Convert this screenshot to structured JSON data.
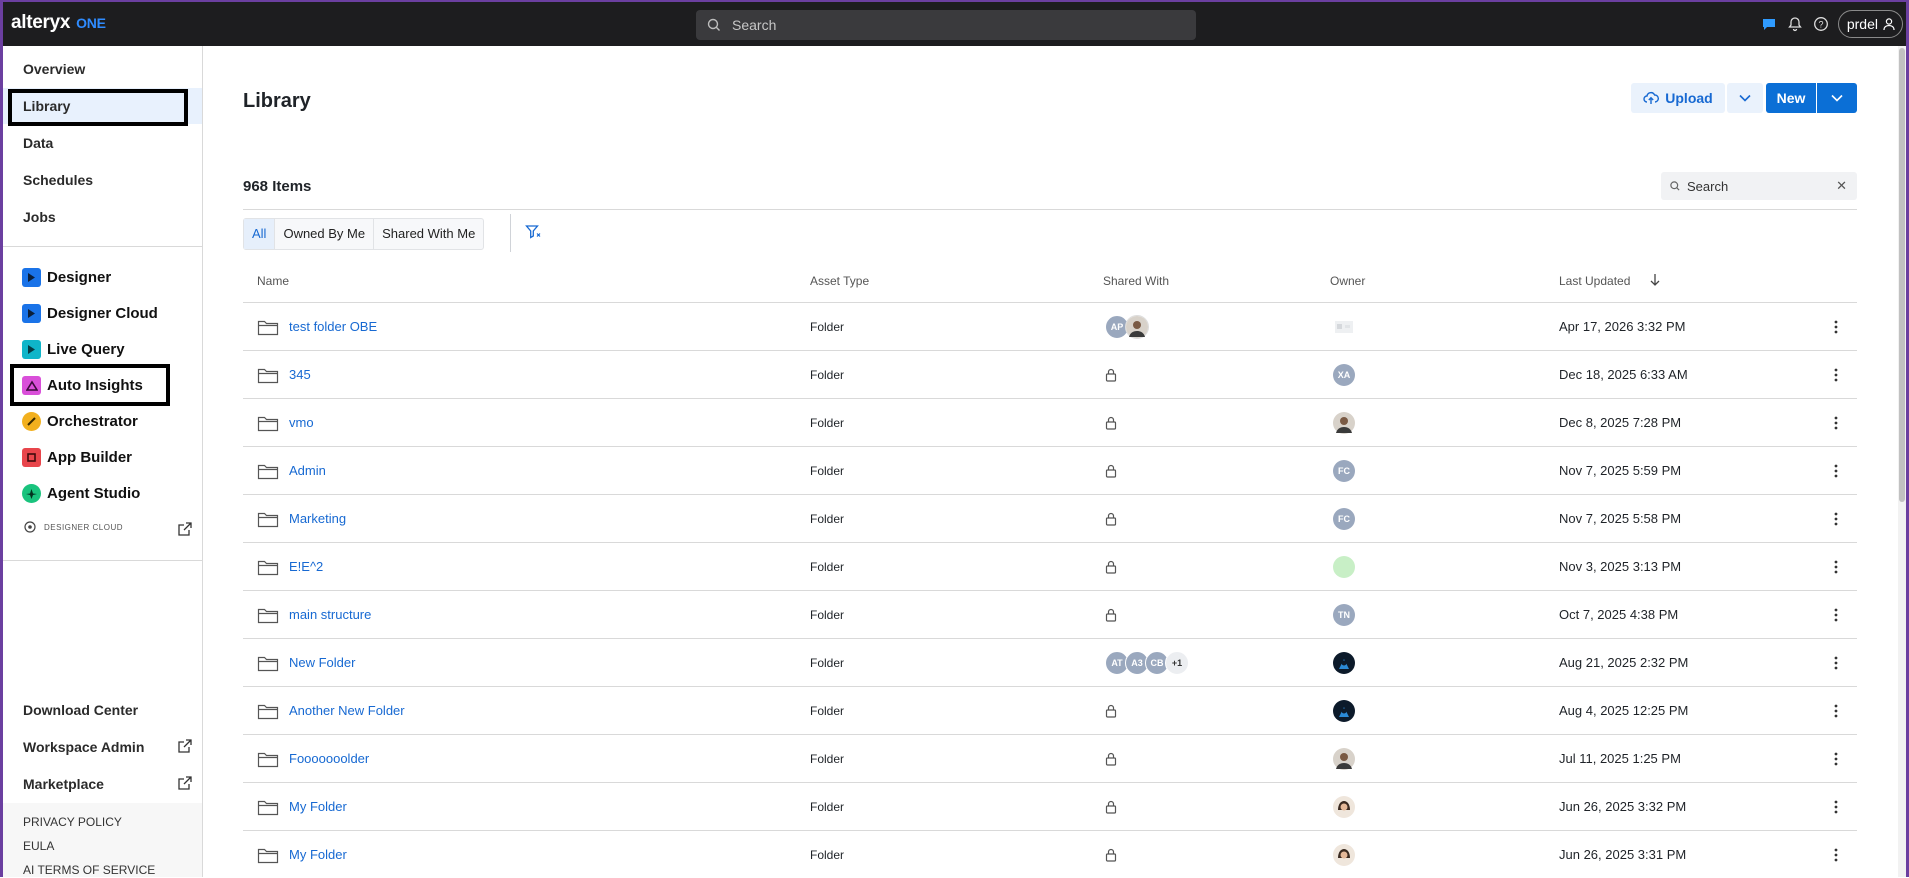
{
  "topbar": {
    "logo_main": "alteryx",
    "logo_sub": "ONE",
    "search_placeholder": "Search",
    "user": "prdel"
  },
  "sidebar": {
    "nav": [
      {
        "label": "Overview"
      },
      {
        "label": "Library"
      },
      {
        "label": "Data"
      },
      {
        "label": "Schedules"
      },
      {
        "label": "Jobs"
      }
    ],
    "apps": [
      {
        "label": "Designer",
        "icon": "designer-icon",
        "color": "#1a73e8"
      },
      {
        "label": "Designer Cloud",
        "icon": "designer-cloud-icon",
        "color": "#1a73e8"
      },
      {
        "label": "Live Query",
        "icon": "live-query-icon",
        "color": "#0fb5c9"
      },
      {
        "label": "Auto Insights",
        "icon": "auto-insights-icon",
        "color": "#d94fd9"
      },
      {
        "label": "Orchestrator",
        "icon": "orchestrator-icon",
        "color": "#f2b01e"
      },
      {
        "label": "App Builder",
        "icon": "app-builder-icon",
        "color": "#e8454b"
      },
      {
        "label": "Agent Studio",
        "icon": "agent-studio-icon",
        "color": "#19c37d"
      }
    ],
    "designer_cloud_logo_text": "DESIGNER CLOUD",
    "bottom": [
      {
        "label": "Download Center"
      },
      {
        "label": "Workspace Admin"
      },
      {
        "label": "Marketplace"
      }
    ],
    "footer": [
      "PRIVACY POLICY",
      "EULA",
      "AI TERMS OF SERVICE"
    ]
  },
  "main": {
    "title": "Library",
    "upload_label": "Upload",
    "new_label": "New",
    "items_count": "968 Items",
    "search_placeholder": "Search",
    "tabs": [
      "All",
      "Owned By Me",
      "Shared With Me"
    ],
    "columns": {
      "name": "Name",
      "asset_type": "Asset Type",
      "shared_with": "Shared With",
      "owner": "Owner",
      "last_updated": "Last Updated"
    },
    "rows": [
      {
        "name": "test folder OBE",
        "type": "Folder",
        "shared": "AP+photo",
        "owner": "blurred",
        "updated": "Apr 17, 2026 3:32 PM"
      },
      {
        "name": "345",
        "type": "Folder",
        "shared": "lock",
        "owner": "XA",
        "updated": "Dec 18, 2025 6:33 AM"
      },
      {
        "name": "vmo",
        "type": "Folder",
        "shared": "lock",
        "owner": "photo-man",
        "updated": "Dec 8, 2025 7:28 PM"
      },
      {
        "name": "Admin",
        "type": "Folder",
        "shared": "lock",
        "owner": "FC",
        "updated": "Nov 7, 2025 5:59 PM"
      },
      {
        "name": "Marketing",
        "type": "Folder",
        "shared": "lock",
        "owner": "FC",
        "updated": "Nov 7, 2025 5:58 PM"
      },
      {
        "name": "E!E^2",
        "type": "Folder",
        "shared": "lock",
        "owner": "green",
        "updated": "Nov 3, 2025 3:13 PM"
      },
      {
        "name": "main structure",
        "type": "Folder",
        "shared": "lock",
        "owner": "TN",
        "updated": "Oct 7, 2025 4:38 PM"
      },
      {
        "name": "New Folder",
        "type": "Folder",
        "shared": "AT,A3,CB,+1",
        "owner": "photo-dark",
        "updated": "Aug 21, 2025 2:32 PM"
      },
      {
        "name": "Another New Folder",
        "type": "Folder",
        "shared": "lock",
        "owner": "photo-dark",
        "updated": "Aug 4, 2025 12:25 PM"
      },
      {
        "name": "Fooooooolder",
        "type": "Folder",
        "shared": "lock",
        "owner": "photo-man",
        "updated": "Jul 11, 2025 1:25 PM"
      },
      {
        "name": "My Folder",
        "type": "Folder",
        "shared": "lock",
        "owner": "photo-woman",
        "updated": "Jun 26, 2025 3:32 PM"
      },
      {
        "name": "My Folder",
        "type": "Folder",
        "shared": "lock",
        "owner": "photo-woman",
        "updated": "Jun 26, 2025 3:31 PM"
      }
    ],
    "shared_avatars_row1": [
      "AP"
    ],
    "shared_avatars_row8": [
      "AT",
      "A3",
      "CB",
      "+1"
    ],
    "owner_initials": {
      "xa": "XA",
      "fc": "FC",
      "tn": "TN"
    }
  }
}
